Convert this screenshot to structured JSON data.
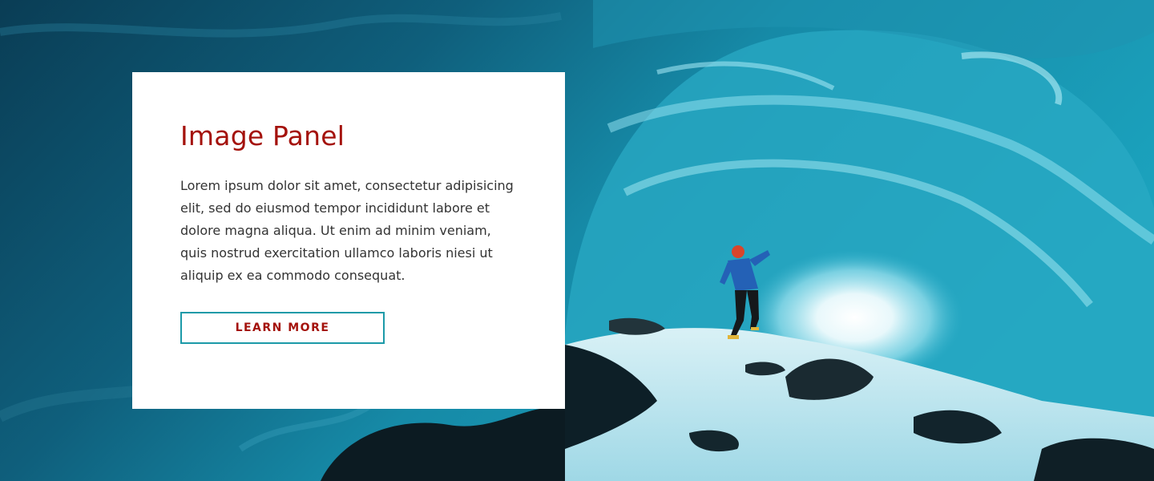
{
  "hero": {
    "image": "ice-cave-with-climber",
    "colors": {
      "deep": "#0b4a63",
      "mid": "#1689a6",
      "ice": "#6ad3e6",
      "glow": "#eaf9fc"
    }
  },
  "panel": {
    "title": "Image Panel",
    "body": "Lorem ipsum dolor sit amet, consectetur adipisicing elit, sed do eiusmod tempor incididunt labore et dolore magna aliqua. Ut enim ad minim veniam, quis nostrud exercitation ullamco laboris niesi ut aliquip ex ea commodo consequat.",
    "cta_label": "LEARN MORE",
    "colors": {
      "title": "#a4120c",
      "button_border": "#1c9aa8",
      "button_text": "#a4120c"
    }
  }
}
